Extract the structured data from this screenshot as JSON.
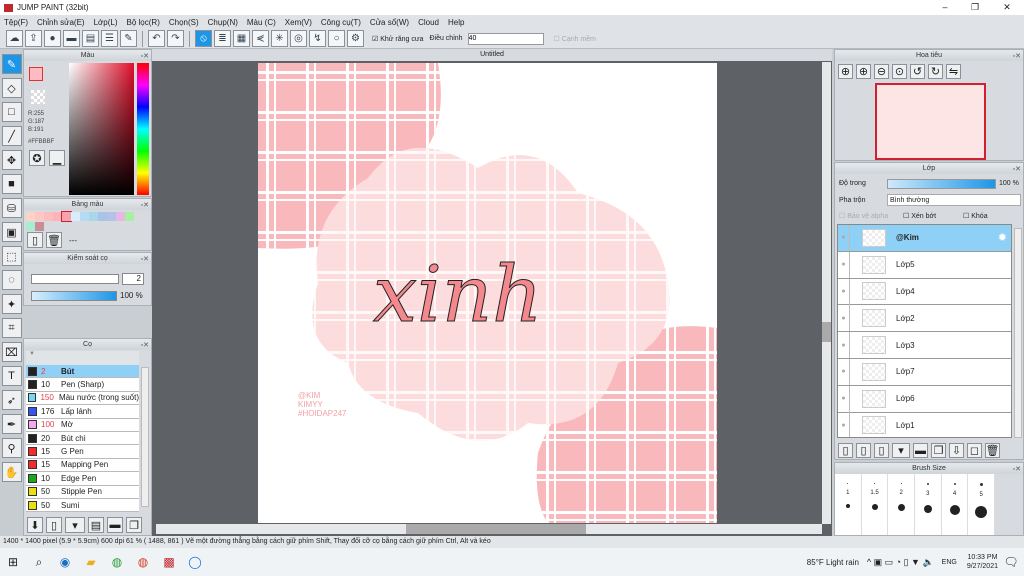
{
  "window": {
    "title": "JUMP PAINT (32bit)"
  },
  "menu": [
    "Tệp(F)",
    "Chỉnh sửa(E)",
    "Lớp(L)",
    "Bộ lọc(R)",
    "Chọn(S)",
    "Chụp(N)",
    "Màu (C)",
    "Xem(V)",
    "Công cụ(T)",
    "Cửa sổ(W)",
    "Cloud",
    "Help"
  ],
  "toolbar": {
    "antialias_label": "Khử răng cưa",
    "adjust_label": "Điều chỉnh",
    "adjust_value": "40",
    "smooth_label": "Cạnh mềm"
  },
  "color_panel": {
    "title": "Màu",
    "r": "R:255",
    "g": "G:187",
    "b": "B:191",
    "hex": "#FFBBBF",
    "fg": "#ffbbbf"
  },
  "palette_panel": {
    "title": "Bảng màu",
    "label": "---",
    "swatches": [
      "#fdd3c8",
      "#fcc8c4",
      "#fcbcc0",
      "#fbb4ba",
      "#f7a3ab",
      "#d8ecfa",
      "#b4dcf6",
      "#a9d6e8",
      "#a9c4e6",
      "#b3c3e6",
      "#eab6ea",
      "#a6f0a0",
      "#a6eed0",
      "#c98e94"
    ]
  },
  "brush_control": {
    "title": "Kiểm soát cọ",
    "size": "2",
    "opacity": "100 %",
    "opacity_fraction": 1.0
  },
  "brush_panel": {
    "title": "Cọ",
    "items": [
      {
        "size": "2",
        "name": "Bút",
        "color": "#222222",
        "selected": true
      },
      {
        "size": "10",
        "name": "Pen (Sharp)",
        "color": "#222222"
      },
      {
        "size": "150",
        "name": "Màu nước (trong suốt)",
        "color": "#7ad6f2"
      },
      {
        "size": "176",
        "name": "Lấp lánh",
        "color": "#3a52f0"
      },
      {
        "size": "100",
        "name": "Mờ",
        "color": "#f4a6f0"
      },
      {
        "size": "20",
        "name": "Bút chì",
        "color": "#222222"
      },
      {
        "size": "15",
        "name": "G Pen",
        "color": "#f02c2c"
      },
      {
        "size": "15",
        "name": "Mapping Pen",
        "color": "#f02c2c"
      },
      {
        "size": "10",
        "name": "Edge Pen",
        "color": "#1aa81a"
      },
      {
        "size": "50",
        "name": "Stipple Pen",
        "color": "#e8e010"
      },
      {
        "size": "50",
        "name": "Sumi",
        "color": "#e8e010"
      }
    ]
  },
  "document": {
    "tab": "Untitled",
    "art_text": "xinh",
    "credit_lines": [
      "@KIM",
      "KIMYY",
      "#HOIDAP247"
    ]
  },
  "navigator": {
    "title": "Hoa tiêu"
  },
  "layers_panel": {
    "title": "Lớp",
    "opacity_label": "Độ trong",
    "opacity_value": "100 %",
    "blend_label": "Pha trộn",
    "blend_value": "Bình thường",
    "protect_alpha": "Bảo vệ alpha",
    "clip": "Xén bớt",
    "lock": "Khóa",
    "layers": [
      "@Kim",
      "Lớp5",
      "Lớp4",
      "Lớp2",
      "Lớp3",
      "Lớp7",
      "Lớp6",
      "Lớp1"
    ]
  },
  "brush_size": {
    "title": "Brush Size",
    "sizes": [
      "1",
      "1.5",
      "2",
      "3",
      "4",
      "5"
    ]
  },
  "status": "1400 * 1400 pixel  (5.9 * 5.9cm)  600 dpi  61 %  ( 1488, 861 )  Vẽ một đường thẳng bằng cách giữ phím Shift, Thay đổi cỡ cọ bằng cách giữ phím Ctrl, Alt và kéo",
  "taskbar": {
    "weather": "85°F  Light rain",
    "lang": "ENG",
    "time": "10:33 PM",
    "date": "9/27/2021"
  }
}
